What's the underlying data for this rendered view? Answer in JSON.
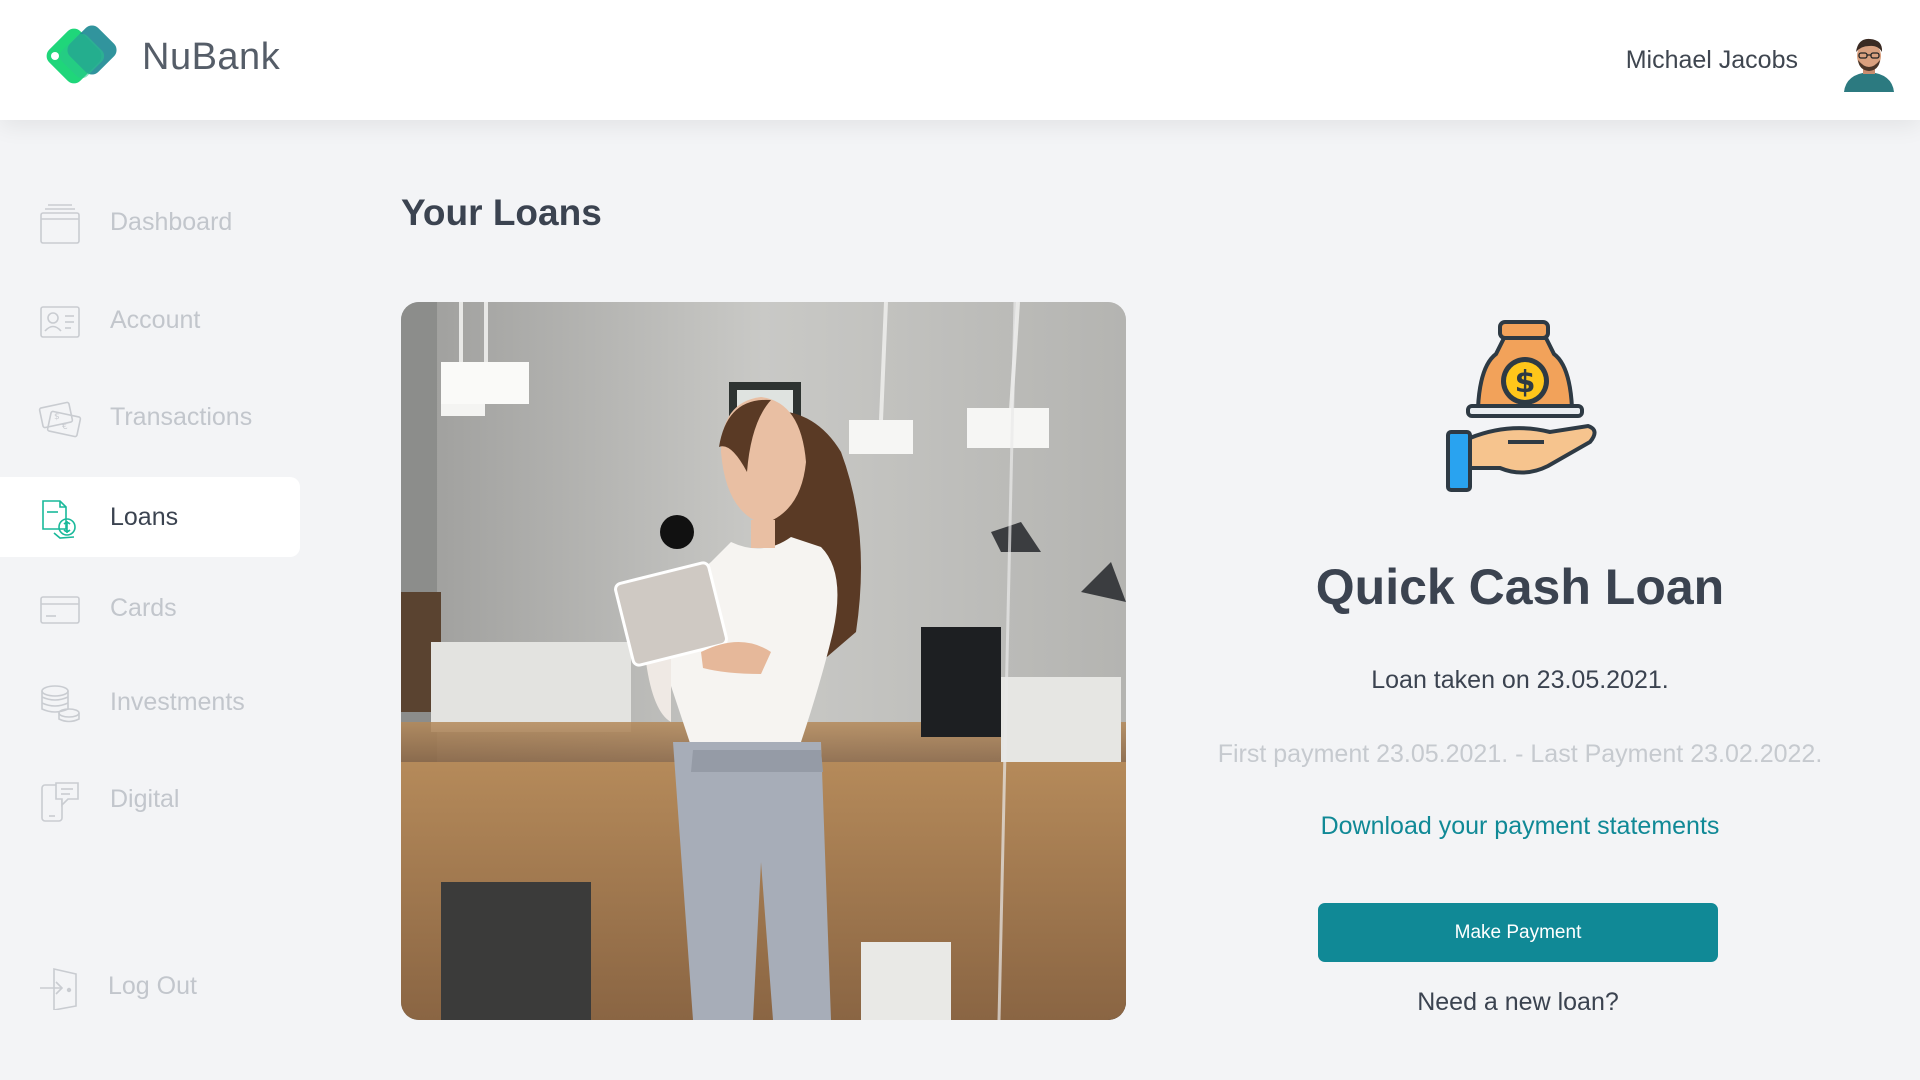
{
  "header": {
    "brand": "NuBank",
    "user_name": "Michael Jacobs"
  },
  "sidebar": {
    "items": [
      {
        "label": "Dashboard",
        "icon": "dashboard-icon"
      },
      {
        "label": "Account",
        "icon": "id-card-icon"
      },
      {
        "label": "Transactions",
        "icon": "banknotes-icon"
      },
      {
        "label": "Loans",
        "icon": "loan-document-icon",
        "active": true
      },
      {
        "label": "Cards",
        "icon": "credit-card-icon"
      },
      {
        "label": "Investments",
        "icon": "coins-stack-icon"
      },
      {
        "label": "Digital",
        "icon": "phone-chat-icon"
      }
    ],
    "logout": {
      "label": "Log Out",
      "icon": "logout-icon"
    }
  },
  "main": {
    "title": "Your Loans",
    "loan": {
      "name": "Quick Cash Loan",
      "taken": "Loan taken on 23.05.2021.",
      "period": "First payment 23.05.2021. - Last Payment 23.02.2022.",
      "download_label": "Download your payment statements",
      "pay_label": "Make Payment",
      "new_loan_label": "Need a new loan?"
    }
  },
  "colors": {
    "accent": "#108996",
    "brand_green": "#1fd67a",
    "text_dark": "#3b4350",
    "text_muted": "#c2c6cc",
    "background": "#f3f4f6"
  }
}
